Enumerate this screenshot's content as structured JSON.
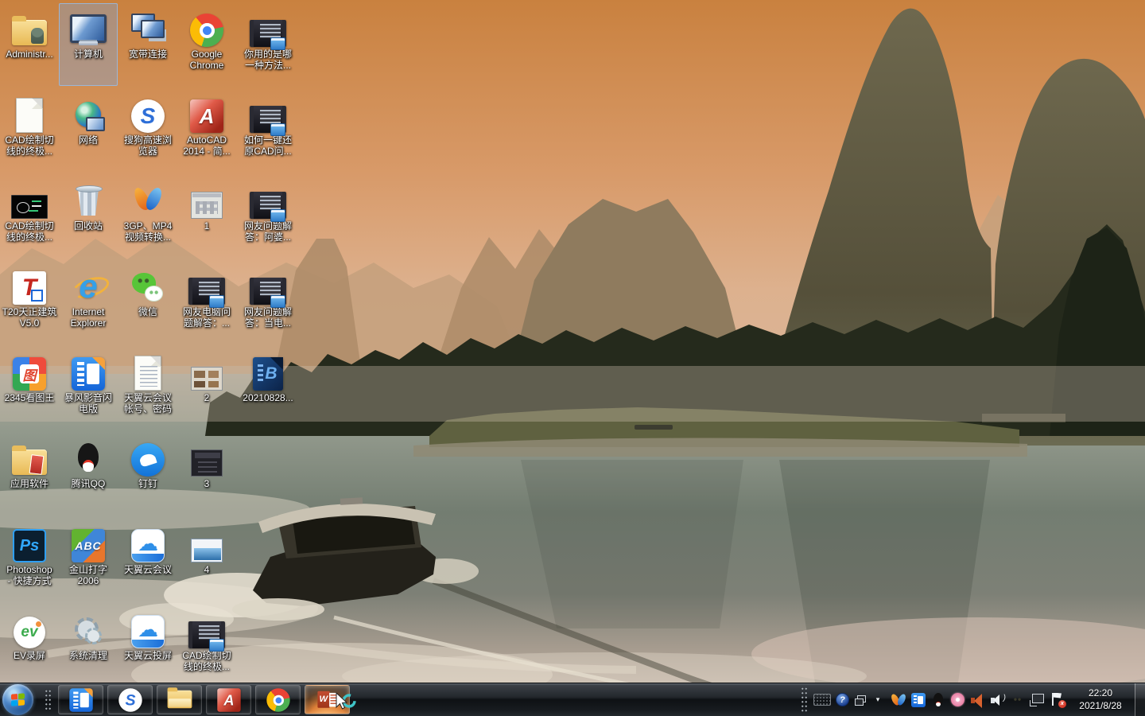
{
  "desktop": {
    "selected_icon": "my-computer",
    "icons": [
      {
        "id": "administrator-folder",
        "type": "folder-admin",
        "label": "Administr...",
        "col": 0,
        "row": 0
      },
      {
        "id": "my-computer",
        "type": "computer",
        "label": "计算机",
        "col": 1,
        "row": 0,
        "selected": true
      },
      {
        "id": "broadband-connection",
        "type": "broadband",
        "label": "宽带连接",
        "col": 2,
        "row": 0
      },
      {
        "id": "google-chrome",
        "type": "chrome",
        "label": "Google\nChrome",
        "col": 3,
        "row": 0
      },
      {
        "id": "video-which-method",
        "type": "media",
        "label": "你用的是哪\n一种方法...",
        "col": 4,
        "row": 0
      },
      {
        "id": "cad-tangent-doc",
        "type": "doc",
        "label": "CAD绘制切\n线的终极...",
        "col": 0,
        "row": 1
      },
      {
        "id": "network",
        "type": "globe",
        "label": "网络",
        "col": 1,
        "row": 1
      },
      {
        "id": "sogou-browser",
        "type": "sogou",
        "label": "搜狗高速浏\n览器",
        "col": 2,
        "row": 1,
        "glyph": "S"
      },
      {
        "id": "autocad-2014",
        "type": "acad",
        "label": "AutoCAD\n2014 - 简...",
        "col": 3,
        "row": 1,
        "glyph": "A"
      },
      {
        "id": "video-restore-cad",
        "type": "media",
        "label": "如何一键还\n原CAD问...",
        "col": 4,
        "row": 1
      },
      {
        "id": "cad-tangent-screenshot",
        "type": "cad",
        "label": "CAD绘制切\n线的终极...",
        "col": 0,
        "row": 2
      },
      {
        "id": "recycle-bin",
        "type": "bin",
        "label": "回收站",
        "col": 1,
        "row": 2
      },
      {
        "id": "video-converter",
        "type": "vee",
        "label": "3GP、MP4\n视频转换...",
        "col": 2,
        "row": 2
      },
      {
        "id": "image-1",
        "type": "thumb-gray",
        "label": "1",
        "col": 3,
        "row": 2
      },
      {
        "id": "video-qa-apo",
        "type": "media",
        "label": "网友问题解\n答：阿婆...",
        "col": 4,
        "row": 2
      },
      {
        "id": "t20-tianzheng",
        "type": "t20",
        "label": "T20天正建筑\nV5.0",
        "col": 0,
        "row": 3,
        "glyph": "T"
      },
      {
        "id": "internet-explorer",
        "type": "ie",
        "label": "Internet\nExplorer",
        "col": 1,
        "row": 3,
        "glyph": "e"
      },
      {
        "id": "wechat",
        "type": "wechat",
        "label": "微信",
        "col": 2,
        "row": 3
      },
      {
        "id": "video-pc-qa",
        "type": "media",
        "label": "网友电脑问\n题解答：...",
        "col": 3,
        "row": 3
      },
      {
        "id": "video-qa-power",
        "type": "media",
        "label": "网友问题解\n答：当电...",
        "col": 4,
        "row": 3
      },
      {
        "id": "2345-picture-viewer",
        "type": "2345",
        "label": "2345看图王",
        "col": 0,
        "row": 4,
        "glyph": "图"
      },
      {
        "id": "baofeng-player",
        "type": "baofeng",
        "label": "暴风影音闪\n电版",
        "col": 1,
        "row": 4
      },
      {
        "id": "cloud-meeting-account",
        "type": "doc-lines",
        "label": "天翼云会议\n帐号、密码",
        "col": 2,
        "row": 4
      },
      {
        "id": "image-2",
        "type": "thumb-photos",
        "label": "2",
        "col": 3,
        "row": 4
      },
      {
        "id": "video-20210828",
        "type": "vid-navy",
        "label": "20210828...",
        "col": 4,
        "row": 4,
        "glyph": "B"
      },
      {
        "id": "app-software-folder",
        "type": "folder-app",
        "label": "应用软件",
        "col": 0,
        "row": 5
      },
      {
        "id": "tencent-qq",
        "type": "qq",
        "label": "腾讯QQ",
        "col": 1,
        "row": 5
      },
      {
        "id": "dingtalk",
        "type": "ding",
        "label": "钉钉",
        "col": 2,
        "row": 5
      },
      {
        "id": "image-3",
        "type": "thumb-dark",
        "label": "3",
        "col": 3,
        "row": 5
      },
      {
        "id": "photoshop-shortcut",
        "type": "ps",
        "label": "Photoshop\n- 快捷方式",
        "col": 0,
        "row": 6,
        "glyph": "Ps"
      },
      {
        "id": "kingsoft-typing-2006",
        "type": "abc",
        "label": "金山打字\n2006",
        "col": 1,
        "row": 6,
        "glyph": "ABC"
      },
      {
        "id": "tianyi-cloud-meeting",
        "type": "cloud",
        "label": "天翼云会议",
        "col": 2,
        "row": 6,
        "glyph": "☁"
      },
      {
        "id": "image-4",
        "type": "thumb-chart",
        "label": "4",
        "col": 3,
        "row": 6
      },
      {
        "id": "ev-recorder",
        "type": "ev",
        "label": "EV录屏",
        "col": 0,
        "row": 7,
        "glyph": "ev"
      },
      {
        "id": "system-clean",
        "type": "gear",
        "label": "系统清理",
        "col": 1,
        "row": 7
      },
      {
        "id": "tianyi-cloud-cast",
        "type": "cloud",
        "label": "天翼云投屏",
        "col": 2,
        "row": 7,
        "glyph": "☁"
      },
      {
        "id": "cad-tangent-video",
        "type": "media",
        "label": "CAD绘制切\n线的终极...",
        "col": 3,
        "row": 7
      }
    ]
  },
  "taskbar": {
    "buttons": [
      {
        "id": "baofeng-player",
        "icon": "baofeng"
      },
      {
        "id": "sogou-browser",
        "icon": "sogou",
        "glyph": "S"
      },
      {
        "id": "windows-explorer",
        "icon": "expl"
      },
      {
        "id": "autocad",
        "icon": "acad",
        "glyph": "A"
      },
      {
        "id": "google-chrome",
        "icon": "chrome"
      },
      {
        "id": "word",
        "icon": "word",
        "glyph": "W",
        "active": true
      }
    ],
    "tray_icons": [
      {
        "id": "input-indicator"
      },
      {
        "id": "input-help",
        "glyph": "?"
      },
      {
        "id": "language-bar-restore"
      },
      {
        "id": "show-hidden-icons",
        "glyph": "▾"
      },
      {
        "id": "video-converter"
      },
      {
        "id": "baofeng-player"
      },
      {
        "id": "tencent-qq"
      },
      {
        "id": "flower-app"
      },
      {
        "id": "audio-manager"
      },
      {
        "id": "volume",
        "glyph": ")"
      },
      {
        "id": "ludashi"
      },
      {
        "id": "network-status"
      },
      {
        "id": "action-center",
        "glyph": "x"
      }
    ],
    "clock": {
      "time": "22:20",
      "date": "2021/8/28"
    }
  },
  "wallpaper": {
    "scene": "Li River karst mountains with boat at dusk",
    "sky_top": "#c9813f",
    "sky_low": "#ddb18e",
    "haze": "#b08d6a",
    "peaks_dark": "#5a5440",
    "trees": "#252a1c",
    "water_mid": "#737d71",
    "water_light": "#bfb2a6",
    "boat_roof": "#c9c2b2"
  }
}
